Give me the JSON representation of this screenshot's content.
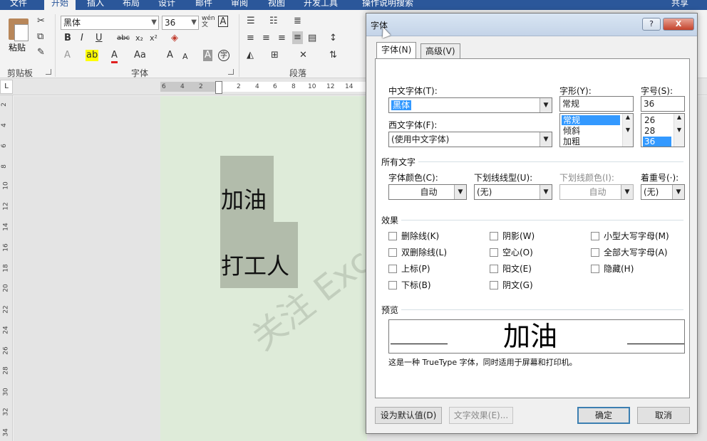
{
  "ribbon_tabs": [
    "文件",
    "开始",
    "插入",
    "布局",
    "设计",
    "邮件",
    "审阅",
    "视图",
    "开发工具",
    "操作说明搜索",
    "共享"
  ],
  "ribbon": {
    "paste_label": "粘贴",
    "group_clipboard": "剪贴板",
    "group_font": "字体",
    "group_paragraph": "段落",
    "font_name": "黑体",
    "font_size": "36",
    "wen_label": "wén 文",
    "bold": "B",
    "italic": "I",
    "underline": "U",
    "strike": "abc",
    "subscript": "x₂",
    "superscript": "x²",
    "grow_font": "A",
    "shrink_font": "A",
    "aa": "Aa"
  },
  "hruler_numbers": [
    "6",
    "4",
    "2",
    "2",
    "4",
    "6",
    "8",
    "10",
    "12",
    "14"
  ],
  "vruler_numbers": [
    "2",
    "4",
    "6",
    "8",
    "10",
    "12",
    "14",
    "16",
    "18",
    "20",
    "22",
    "24",
    "26",
    "28",
    "30",
    "32",
    "34"
  ],
  "document": {
    "line1": "加油",
    "line2": "打工人",
    "watermark": "关注 Exc"
  },
  "dialog": {
    "title": "字体",
    "help_label": "?",
    "close_label": "X",
    "tabs": [
      "字体(N)",
      "高级(V)"
    ],
    "chinese_font_label": "中文字体(T):",
    "chinese_font_value": "黑体",
    "western_font_label": "西文字体(F):",
    "western_font_value": "(使用中文字体)",
    "style_label": "字形(Y):",
    "style_value": "常规",
    "style_options": [
      "常规",
      "倾斜",
      "加粗"
    ],
    "size_label": "字号(S):",
    "size_value": "36",
    "size_options": [
      "26",
      "28",
      "36"
    ],
    "all_text_label": "所有文字",
    "font_color_label": "字体颜色(C):",
    "font_color_value": "自动",
    "underline_type_label": "下划线线型(U):",
    "underline_type_value": "(无)",
    "underline_color_label": "下划线颜色(I):",
    "underline_color_value": "自动",
    "emphasis_label": "着重号(·):",
    "emphasis_value": "(无)",
    "effects_label": "效果",
    "effects": [
      [
        "删除线(K)",
        "阴影(W)",
        "小型大写字母(M)"
      ],
      [
        "双删除线(L)",
        "空心(O)",
        "全部大写字母(A)"
      ],
      [
        "上标(P)",
        "阳文(E)",
        "隐藏(H)"
      ],
      [
        "下标(B)",
        "阴文(G)"
      ]
    ],
    "preview_label": "预览",
    "preview_text": "加油",
    "note": "这是一种 TrueType 字体，同时适用于屏幕和打印机。",
    "btn_default": "设为默认值(D)",
    "btn_text_effects": "文字效果(E)...",
    "btn_ok": "确定",
    "btn_cancel": "取消"
  },
  "colors": {
    "ribbon_blue": "#2b579a",
    "page_bg": "#deebd9",
    "textbox_bg": "#b2bcab",
    "selection": "#3399ff"
  }
}
